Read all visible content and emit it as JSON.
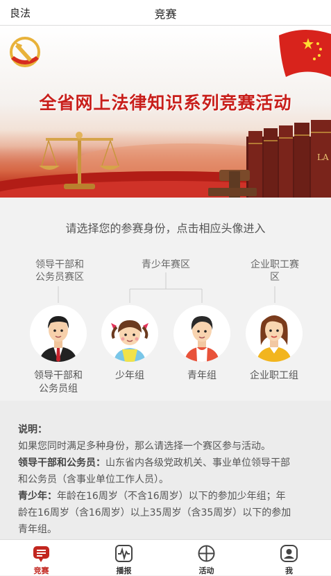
{
  "header": {
    "back_label": "良法",
    "title": "竞赛"
  },
  "banner": {
    "headline": "全省网上法律知识系列竞赛活动",
    "book_label": "LA"
  },
  "prompt": "请选择您的参赛身份，点击相应头像进入",
  "groups": {
    "leaders": [
      "领导干部和",
      "公务员赛区"
    ],
    "youth": "青少年赛区",
    "enterprise": [
      "企业职工赛",
      "区"
    ]
  },
  "avatars": [
    {
      "id": "leader",
      "label": [
        "领导干部和",
        "公务员组"
      ]
    },
    {
      "id": "child",
      "label": [
        "少年组"
      ]
    },
    {
      "id": "youth",
      "label": [
        "青年组"
      ]
    },
    {
      "id": "worker",
      "label": [
        "企业职工组"
      ]
    }
  ],
  "notes": {
    "heading": "说明：",
    "line1": "如果您同时满足多种身份，那么请选择一个赛区参与活动。",
    "leaders_term": "领导干部和公务员：",
    "leaders_text": "山东省内各级党政机关、事业单位领导干部",
    "leaders_text2": "和公务员（含事业单位工作人员）。",
    "youth_term": "青少年：",
    "youth_text": "年龄在16周岁（不含16周岁）以下的参加少年组；年",
    "youth_text2": "龄在16周岁（含16周岁）以上35周岁（含35周岁）以下的参加",
    "youth_text3": "青年组。"
  },
  "tabs": [
    {
      "label": "竞赛",
      "icon": "contest-icon",
      "active": true
    },
    {
      "label": "播报",
      "icon": "broadcast-icon",
      "active": false
    },
    {
      "label": "活动",
      "icon": "activity-icon",
      "active": false
    },
    {
      "label": "我",
      "icon": "profile-icon",
      "active": false
    }
  ],
  "colors": {
    "accent": "#c2261f",
    "banner_red": "#b21d16"
  }
}
